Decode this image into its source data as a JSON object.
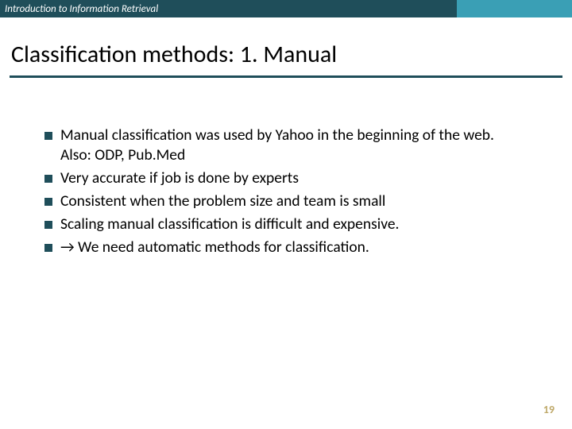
{
  "header": {
    "course": "Introduction to Information Retrieval"
  },
  "title": "Classification methods: 1. Manual",
  "bullets": [
    "Manual classification was used by Yahoo in the beginning of the web. Also: ODP, Pub.Med",
    "Very accurate if job is done by experts",
    "Consistent when the problem size and team is small",
    "Scaling manual classification is difficult and expensive.",
    "→ We need automatic methods for classification."
  ],
  "page_number": "19"
}
